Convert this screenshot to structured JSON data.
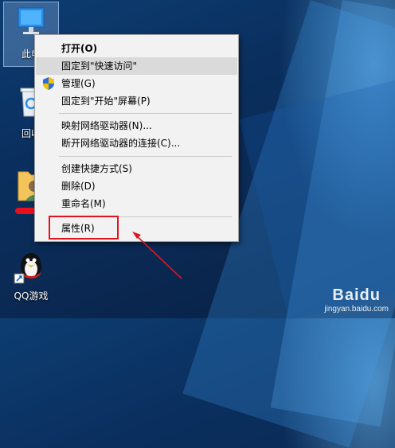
{
  "desktop": {
    "icons": [
      {
        "label": "此电"
      },
      {
        "label": "回收"
      },
      {
        "label": ""
      },
      {
        "label": "QQ游戏"
      }
    ]
  },
  "context_menu": {
    "items": [
      {
        "label": "打开(O)"
      },
      {
        "label": "固定到\"快速访问\""
      },
      {
        "label": "管理(G)"
      },
      {
        "label": "固定到\"开始\"屏幕(P)"
      },
      {
        "label": "映射网络驱动器(N)..."
      },
      {
        "label": "断开网络驱动器的连接(C)..."
      },
      {
        "label": "创建快捷方式(S)"
      },
      {
        "label": "删除(D)"
      },
      {
        "label": "重命名(M)"
      },
      {
        "label": "属性(R)"
      }
    ],
    "highlighted_item": "固定到\"快速访问\"",
    "callout_item": "属性(R)"
  },
  "watermark": {
    "brand": "Baidu",
    "site": "jingyan.baidu.com"
  },
  "colors": {
    "callout": "#e0141e",
    "accent_shield_blue": "#2b6fd6",
    "accent_shield_yellow": "#f2c200"
  }
}
